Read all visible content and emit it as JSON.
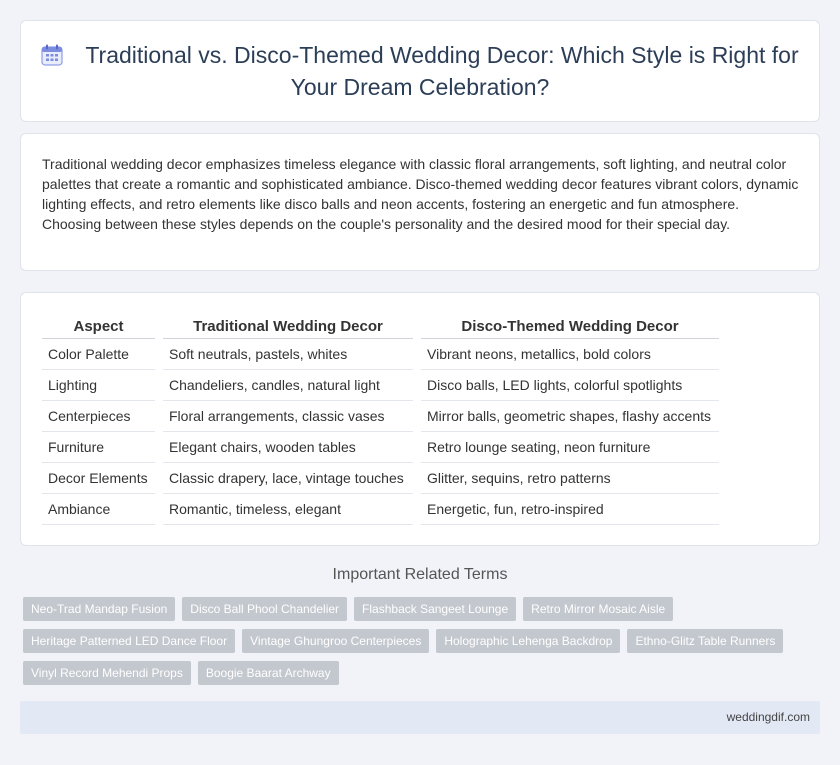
{
  "header": {
    "title": "Traditional vs. Disco-Themed Wedding Decor: Which Style is Right for Your Dream Celebration?",
    "icon": "calendar-icon"
  },
  "intro": {
    "text": "Traditional wedding decor emphasizes timeless elegance with classic floral arrangements, soft lighting, and neutral color palettes that create a romantic and sophisticated ambiance. Disco-themed wedding decor features vibrant colors, dynamic lighting effects, and retro elements like disco balls and neon accents, fostering an energetic and fun atmosphere. Choosing between these styles depends on the couple's personality and the desired mood for their special day."
  },
  "table": {
    "headers": [
      "Aspect",
      "Traditional Wedding Decor",
      "Disco-Themed Wedding Decor"
    ],
    "rows": [
      [
        "Color Palette",
        "Soft neutrals, pastels, whites",
        "Vibrant neons, metallics, bold colors"
      ],
      [
        "Lighting",
        "Chandeliers, candles, natural light",
        "Disco balls, LED lights, colorful spotlights"
      ],
      [
        "Centerpieces",
        "Floral arrangements, classic vases",
        "Mirror balls, geometric shapes, flashy accents"
      ],
      [
        "Furniture",
        "Elegant chairs, wooden tables",
        "Retro lounge seating, neon furniture"
      ],
      [
        "Decor Elements",
        "Classic drapery, lace, vintage touches",
        "Glitter, sequins, retro patterns"
      ],
      [
        "Ambiance",
        "Romantic, timeless, elegant",
        "Energetic, fun, retro-inspired"
      ]
    ]
  },
  "related": {
    "title": "Important Related Terms",
    "tags": [
      "Neo-Trad Mandap Fusion",
      "Disco Ball Phool Chandelier",
      "Flashback Sangeet Lounge",
      "Retro Mirror Mosaic Aisle",
      "Heritage Patterned LED Dance Floor",
      "Vintage Ghungroo Centerpieces",
      "Holographic Lehenga Backdrop",
      "Ethno-Glitz Table Runners",
      "Vinyl Record Mehendi Props",
      "Boogie Baarat Archway"
    ]
  },
  "footer": {
    "site": "weddingdif.com"
  },
  "colors": {
    "title": "#2c3e57",
    "tag_bg": "#c3c7ce",
    "footer_bg": "#e3e8f5",
    "page_bg": "#f1f3f8"
  }
}
